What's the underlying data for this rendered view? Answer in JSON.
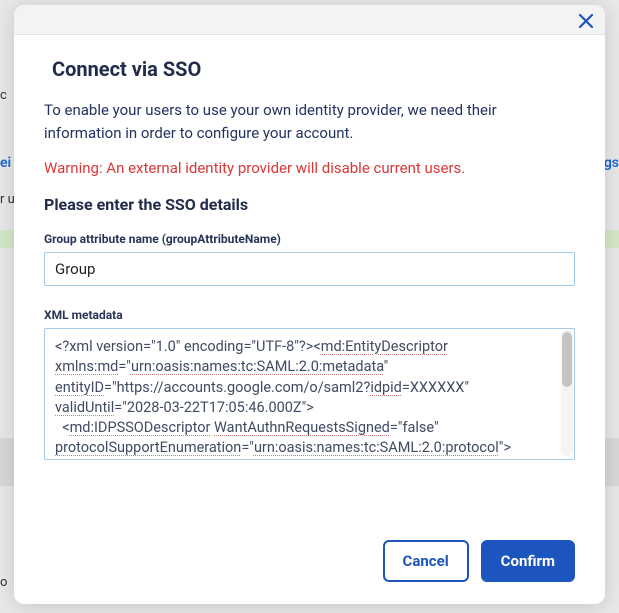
{
  "modal": {
    "title": "Connect via SSO",
    "intro": "To enable your users to use your own identity provider, we need their information in order to configure your account.",
    "warning": "Warning: An external identity provider will disable current users.",
    "subheading": "Please enter the SSO details",
    "fields": {
      "group_attr": {
        "label": "Group attribute name (groupAttributeName)",
        "value": "Group"
      },
      "xml_meta": {
        "label": "XML metadata",
        "value": "<?xml version=\"1.0\" encoding=\"UTF-8\"?><md:EntityDescriptor xmlns:md=\"urn:oasis:names:tc:SAML:2.0:metadata\" entityID=\"https://accounts.google.com/o/saml2?idpid=XXXXXX\" validUntil=\"2028-03-22T17:05:46.000Z\">\n  <md:IDPSSODescriptor WantAuthnRequestsSigned=\"false\" protocolSupportEnumeration=\"urn:oasis:names:tc:SAML:2.0:protocol\">"
      }
    },
    "buttons": {
      "cancel": "Cancel",
      "confirm": "Confirm"
    }
  },
  "background": {
    "left_fragment_1": "c",
    "left_fragment_2": "ei",
    "left_fragment_3": "r u",
    "left_fragment_4": "o",
    "right_fragment": "gs"
  }
}
